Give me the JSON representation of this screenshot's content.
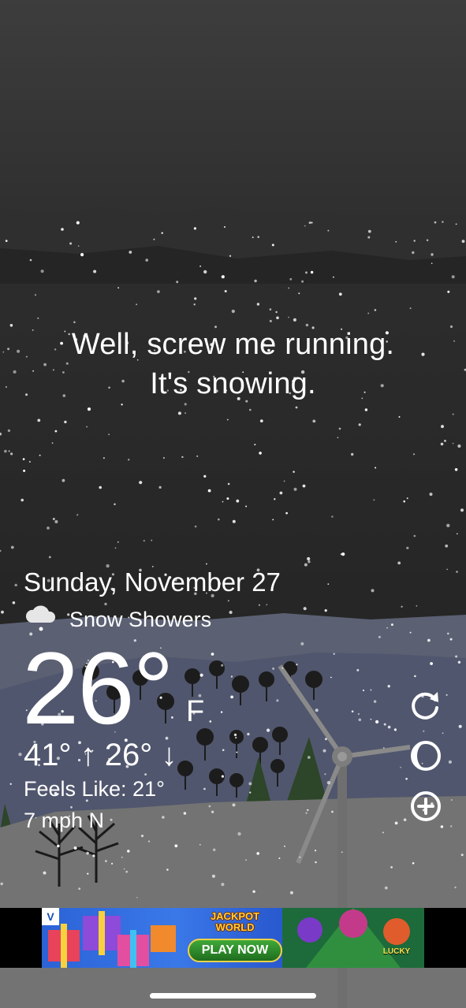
{
  "headline": {
    "line1": "Well, screw me running.",
    "line2": "It's snowing."
  },
  "weather": {
    "date": "Sunday, November 27",
    "condition": "Snow Showers",
    "condition_icon": "snow-cloud-icon",
    "temperature": "26°",
    "unit": "F",
    "high": "41°",
    "low": "26°",
    "feels_like": "Feels Like: 21°",
    "wind": "7 mph N"
  },
  "controls": {
    "refresh_icon": "refresh-icon",
    "theme_icon": "moon-icon",
    "add_icon": "add-location-icon"
  },
  "ad": {
    "brand": "JACKPOT WORLD",
    "cta": "PLAY NOW",
    "tag": "LUCKY"
  },
  "colors": {
    "sky": "#1f1f1f",
    "haze": "#3a3a3a",
    "far_hills": "#5d6275",
    "near_hills": "#4f566e",
    "snow_ground": "#777777",
    "tree_green": "#2f4a2a"
  }
}
